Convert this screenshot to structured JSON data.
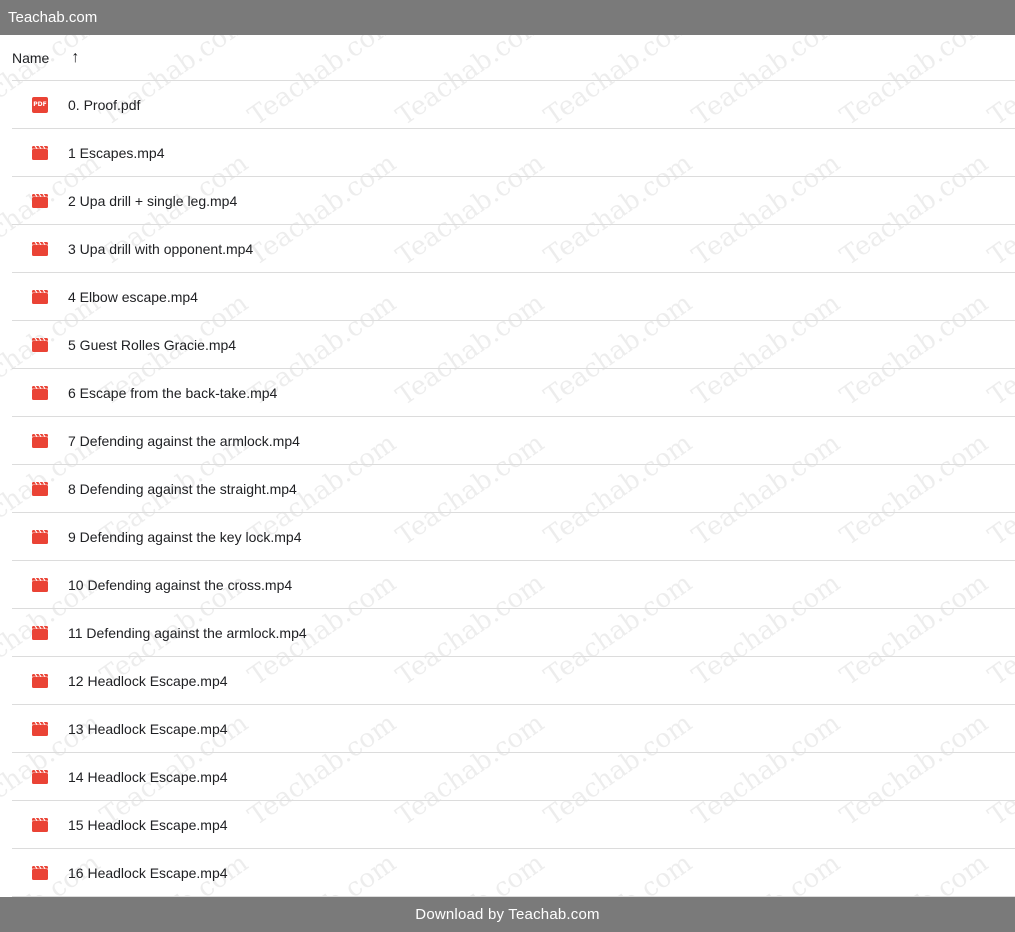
{
  "app": {
    "title": "Teachab.com"
  },
  "header": {
    "name_label": "Name",
    "sort_icon": "↑"
  },
  "files": [
    {
      "name": "0. Proof.pdf",
      "type": "pdf",
      "icon": "pdf-icon",
      "icon_text": "PDF"
    },
    {
      "name": "1 Escapes.mp4",
      "type": "video",
      "icon": "video-icon"
    },
    {
      "name": "2 Upa drill + single leg.mp4",
      "type": "video",
      "icon": "video-icon"
    },
    {
      "name": "3 Upa drill with opponent.mp4",
      "type": "video",
      "icon": "video-icon"
    },
    {
      "name": "4 Elbow escape.mp4",
      "type": "video",
      "icon": "video-icon"
    },
    {
      "name": "5 Guest Rolles Gracie.mp4",
      "type": "video",
      "icon": "video-icon"
    },
    {
      "name": "6 Escape from the back-take.mp4",
      "type": "video",
      "icon": "video-icon"
    },
    {
      "name": "7 Defending against the armlock.mp4",
      "type": "video",
      "icon": "video-icon"
    },
    {
      "name": "8 Defending against the straight.mp4",
      "type": "video",
      "icon": "video-icon"
    },
    {
      "name": "9 Defending against the key lock.mp4",
      "type": "video",
      "icon": "video-icon"
    },
    {
      "name": "10 Defending against the cross.mp4",
      "type": "video",
      "icon": "video-icon"
    },
    {
      "name": "11 Defending against the armlock.mp4",
      "type": "video",
      "icon": "video-icon"
    },
    {
      "name": "12 Headlock Escape.mp4",
      "type": "video",
      "icon": "video-icon"
    },
    {
      "name": "13 Headlock Escape.mp4",
      "type": "video",
      "icon": "video-icon"
    },
    {
      "name": "14 Headlock Escape.mp4",
      "type": "video",
      "icon": "video-icon"
    },
    {
      "name": "15 Headlock Escape.mp4",
      "type": "video",
      "icon": "video-icon"
    },
    {
      "name": "16 Headlock Escape.mp4",
      "type": "video",
      "icon": "video-icon"
    }
  ],
  "footer": {
    "text": "Download by Teachab.com"
  },
  "watermark": {
    "text": "Teachab.com"
  },
  "colors": {
    "bar": "#7a7a7a",
    "icon_red": "#ea4335",
    "divider": "#dcdcdc"
  }
}
